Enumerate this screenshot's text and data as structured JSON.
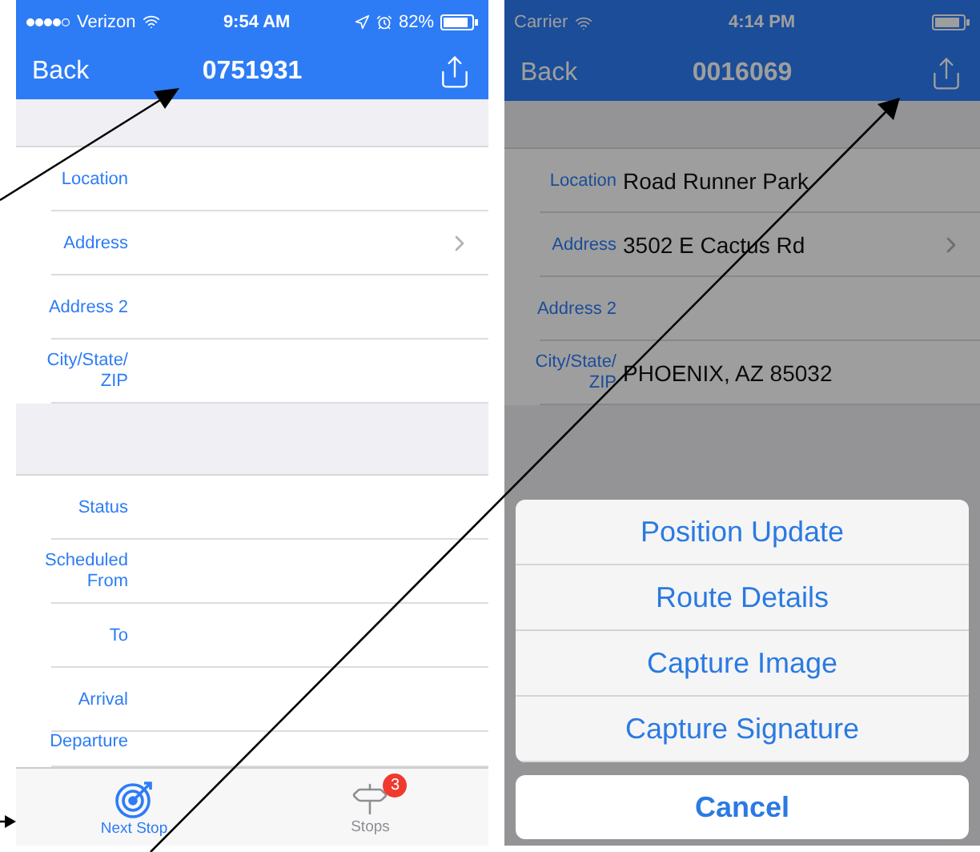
{
  "screens": [
    {
      "dimmed": false,
      "status_bar": {
        "signal": true,
        "carrier": "Verizon",
        "time": "9:54 AM",
        "indicators": true,
        "battery": "82%"
      },
      "nav": {
        "back": "Back",
        "title": "0751931"
      },
      "sections": [
        [
          {
            "label": "Location",
            "disclosure": false
          },
          {
            "label": "Address",
            "disclosure": true
          },
          {
            "label": "Address 2",
            "disclosure": false
          },
          {
            "label": "City/State/ ZIP",
            "disclosure": false
          }
        ],
        [
          {
            "label": "Status",
            "disclosure": false
          },
          {
            "label": "Scheduled From",
            "disclosure": false
          },
          {
            "label": "To",
            "disclosure": false
          },
          {
            "label": "Arrival",
            "disclosure": false
          },
          {
            "label": "Departure",
            "disclosure": false
          }
        ]
      ],
      "tab_bar": [
        {
          "kind": "target",
          "label": "Next Stop",
          "selected": true
        },
        {
          "kind": "signpost",
          "label": "Stops",
          "selected": false,
          "badge": "3"
        }
      ]
    },
    {
      "dimmed": true,
      "status_bar": {
        "signal": false,
        "carrier": "Carrier",
        "time": "4:14 PM",
        "indicators": false
      },
      "nav": {
        "back": "Back",
        "title": "0016069"
      },
      "sections": [
        [
          {
            "label": "Location",
            "value": "Road Runner Park",
            "disclosure": false
          },
          {
            "label": "Address",
            "value": "3502 E Cactus Rd",
            "disclosure": true
          },
          {
            "label": "Address 2",
            "disclosure": false
          },
          {
            "label": "City/State/ ZIP",
            "value": "PHOENIX, AZ 85032",
            "disclosure": false
          }
        ]
      ],
      "action_sheet": {
        "items": [
          "Position Update",
          "Route Details",
          "Capture Image",
          "Capture Signature"
        ],
        "cancel": "Cancel"
      }
    }
  ]
}
